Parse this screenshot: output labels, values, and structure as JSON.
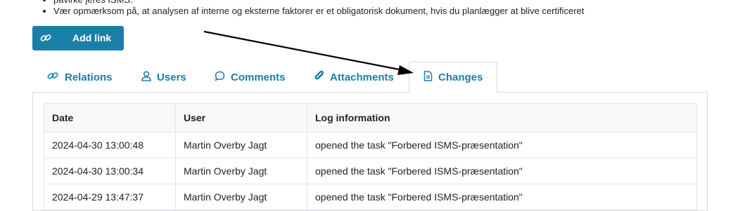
{
  "bullets": [
    "påvirke jeres ISMS.",
    "Vær opmærksom på, at analysen af interne og eksterne faktorer er et obligatorisk dokument, hvis du planlægger at blive certificeret"
  ],
  "add_link": {
    "label": "Add link",
    "icon": "link-icon"
  },
  "tabs": [
    {
      "label": "Relations",
      "icon": "link-icon"
    },
    {
      "label": "Users",
      "icon": "user-icon"
    },
    {
      "label": "Comments",
      "icon": "comment-icon"
    },
    {
      "label": "Attachments",
      "icon": "paperclip-icon"
    },
    {
      "label": "Changes",
      "icon": "document-icon",
      "active": true
    }
  ],
  "table": {
    "headers": [
      "Date",
      "User",
      "Log information"
    ],
    "rows": [
      [
        "2024-04-30 13:00:48",
        "Martin Overby Jagt",
        "opened the task \"Forbered ISMS-præsentation\""
      ],
      [
        "2024-04-30 13:00:34",
        "Martin Overby Jagt",
        "opened the task \"Forbered ISMS-præsentation\""
      ],
      [
        "2024-04-29 13:47:37",
        "Martin Overby Jagt",
        "opened the task \"Forbered ISMS-præsentation\""
      ]
    ]
  },
  "colors": {
    "accent": "#1a7fa6",
    "annotation_arrow": "#000000"
  }
}
